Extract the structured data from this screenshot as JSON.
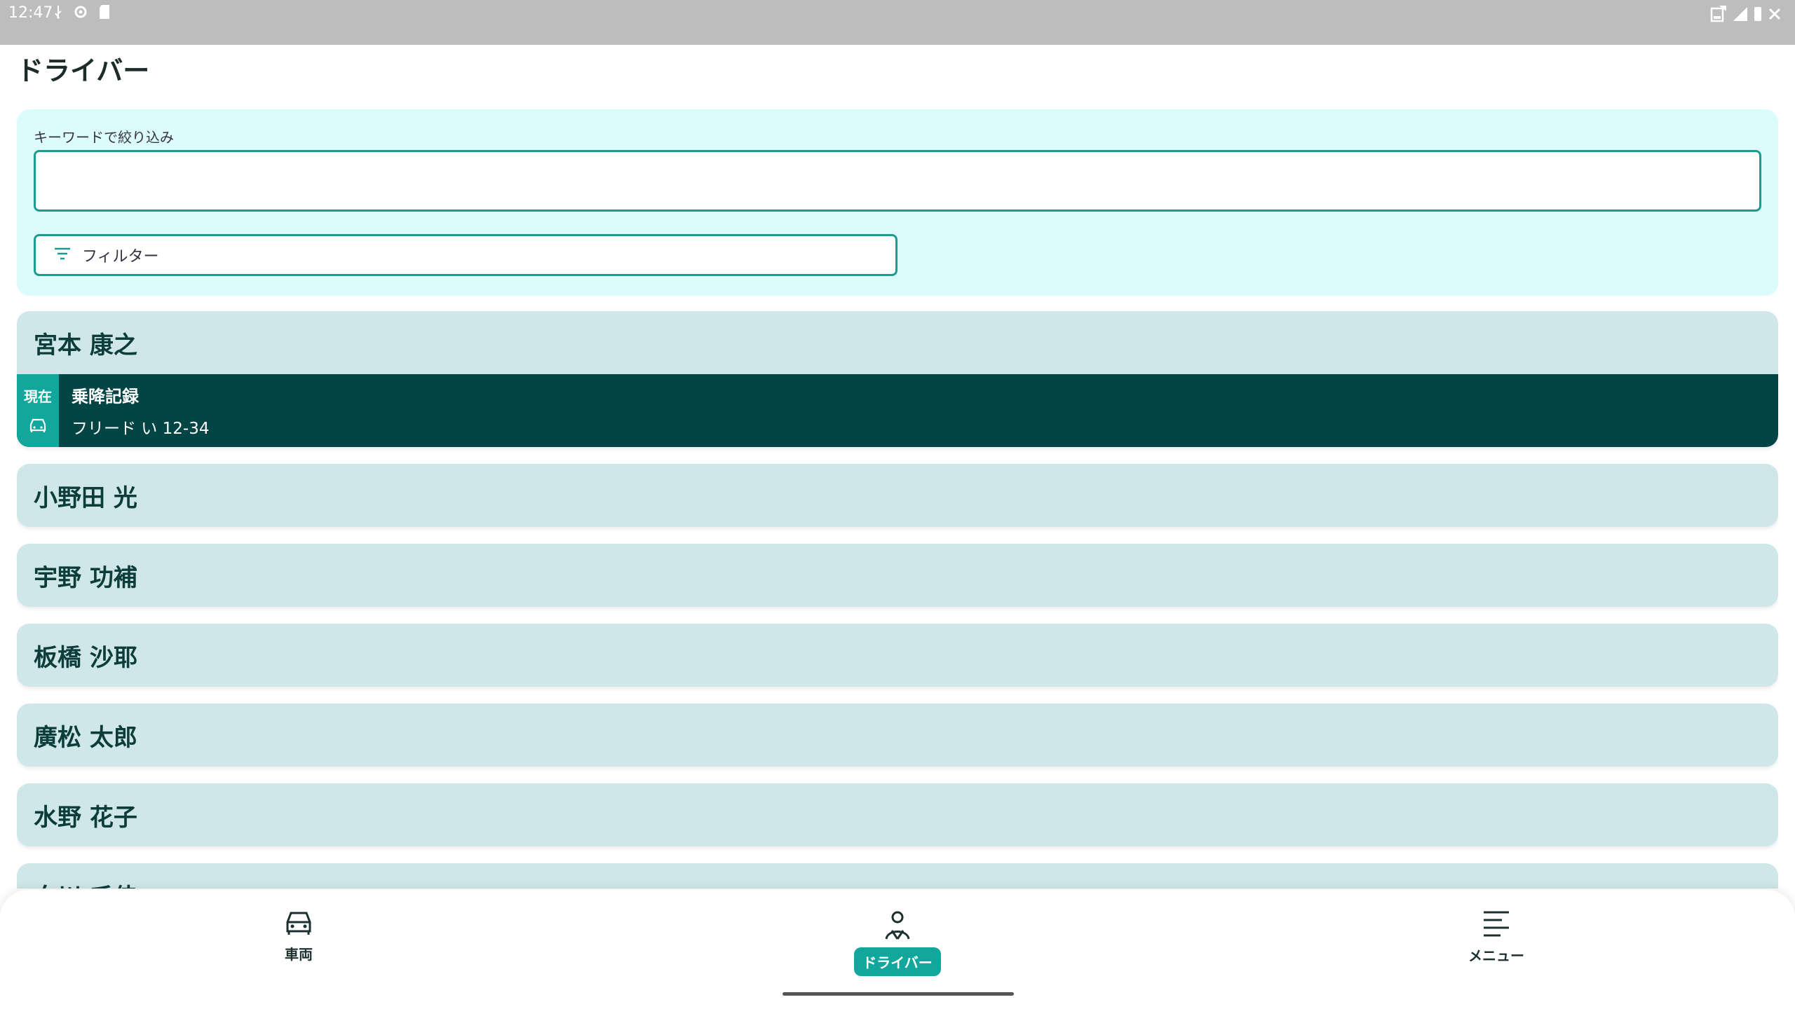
{
  "status": {
    "time": "12:47"
  },
  "page": {
    "title": "ドライバー"
  },
  "filters": {
    "keyword_label": "キーワードで絞り込み",
    "keyword_value": "",
    "filter_label": "フィルター"
  },
  "drivers": [
    {
      "name": "宮本 康之",
      "current": {
        "badge": "現在",
        "title": "乗降記録",
        "vehicle": "フリード い 12-34"
      }
    },
    {
      "name": "小野田 光"
    },
    {
      "name": "宇野 功補"
    },
    {
      "name": "板橋 沙耶"
    },
    {
      "name": "廣松 太郎"
    },
    {
      "name": "水野 花子"
    },
    {
      "name": "白川 千佳"
    }
  ],
  "nav": {
    "vehicles": "車両",
    "drivers": "ドライバー",
    "menu": "メニュー"
  },
  "colors": {
    "accent": "#12a79c",
    "dark": "#034545",
    "card": "#cfe7e8",
    "panel": "#dcfcfb"
  }
}
